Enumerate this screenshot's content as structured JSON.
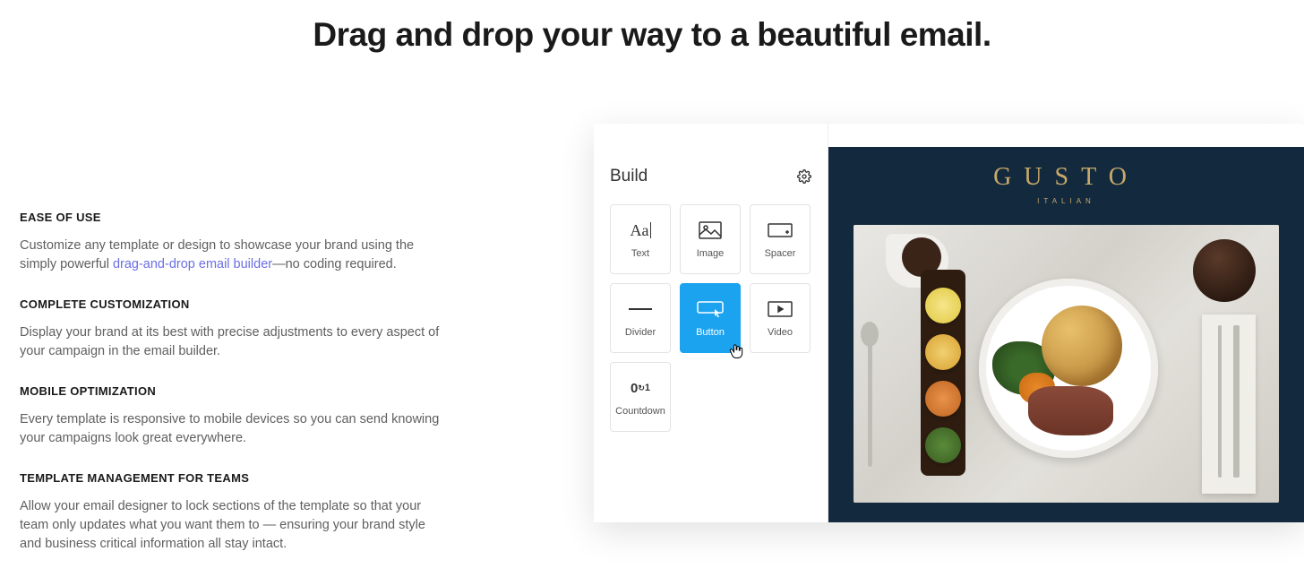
{
  "hero": {
    "title": "Drag and drop your way to a beautiful email."
  },
  "features": [
    {
      "heading": "EASE OF USE",
      "body_pre": "Customize any template or design to showcase your brand using the simply powerful ",
      "link": "drag-and-drop email builder",
      "body_post": "—no coding required."
    },
    {
      "heading": "COMPLETE CUSTOMIZATION",
      "body": "Display your brand at its best with precise adjustments to every aspect of your campaign in the email builder."
    },
    {
      "heading": "MOBILE OPTIMIZATION",
      "body": "Every template is responsive to mobile devices so you can send knowing your campaigns look great everywhere."
    },
    {
      "heading": "TEMPLATE MANAGEMENT FOR TEAMS",
      "body": "Allow your email designer to lock sections of the template so that your team only updates what you want them to — ensuring your brand style and business critical information all stay intact."
    }
  ],
  "editor": {
    "panel_title": "Build",
    "blocks": {
      "text": "Text",
      "image": "Image",
      "spacer": "Spacer",
      "divider": "Divider",
      "button": "Button",
      "video": "Video",
      "countdown": "Countdown"
    },
    "active_block": "button"
  },
  "preview": {
    "brand": "GUSTO",
    "brand_sub": "ITALIAN"
  }
}
